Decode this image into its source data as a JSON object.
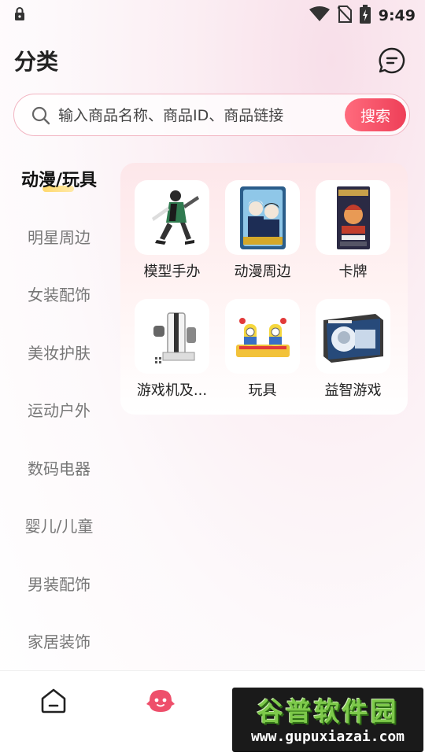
{
  "status_bar": {
    "time": "9:49"
  },
  "header": {
    "title": "分类"
  },
  "search": {
    "placeholder": "输入商品名称、商品ID、商品链接",
    "button_label": "搜索"
  },
  "sidebar": {
    "items": [
      {
        "label": "动漫/玩具",
        "active": true
      },
      {
        "label": "明星周边"
      },
      {
        "label": "女装配饰"
      },
      {
        "label": "美妆护肤"
      },
      {
        "label": "运动户外"
      },
      {
        "label": "数码电器"
      },
      {
        "label": "婴儿/儿童"
      },
      {
        "label": "男装配饰"
      },
      {
        "label": "家居装饰"
      }
    ]
  },
  "categories": [
    {
      "label": "模型手办",
      "icon": "anime-figure-image"
    },
    {
      "label": "动漫周边",
      "icon": "anime-merch-image"
    },
    {
      "label": "卡牌",
      "icon": "card-pack-image"
    },
    {
      "label": "游戏机及...",
      "icon": "game-console-image"
    },
    {
      "label": "玩具",
      "icon": "toy-image"
    },
    {
      "label": "益智游戏",
      "icon": "puzzle-box-image"
    }
  ],
  "bottom_nav": {
    "items": [
      {
        "icon": "home-icon"
      },
      {
        "icon": "category-face-icon",
        "color": "#ee4f6b"
      }
    ]
  },
  "watermark": {
    "title": "谷普软件园",
    "url": "www.gupuxiazai.com"
  },
  "colors": {
    "accent": "#ee3f58",
    "active_underline": "#ffd86b"
  }
}
